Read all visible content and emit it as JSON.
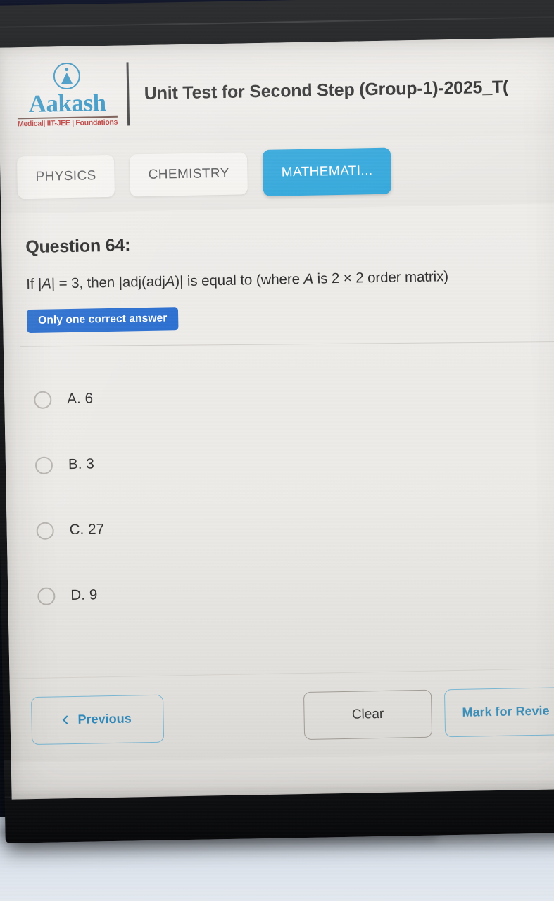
{
  "app": {
    "exam_title": "Unit Test for Second Step (Group-1)-2025_T(",
    "logo": {
      "word": "Aakash",
      "subtitle": "Medical| IIT-JEE | Foundations",
      "mark_icon": "aakash-circle-icon"
    }
  },
  "tabs": [
    {
      "label": "PHYSICS",
      "active": false
    },
    {
      "label": "CHEMISTRY",
      "active": false
    },
    {
      "label": "MATHEMATI...",
      "active": true
    }
  ],
  "question": {
    "number_label": "Question 64:",
    "text_part1": "If |",
    "text_italic1": "A",
    "text_part2": "| = 3, then |adj(adj",
    "text_italic2": "A",
    "text_part3": ")| is equal to (where ",
    "text_italic3": "A",
    "text_part4": " is 2 × 2 order matrix)",
    "full_text": "If |A| = 3, then |adj(adjA)| is equal to (where A is 2 × 2 order matrix)",
    "answer_type_badge": "Only one correct answer",
    "options": [
      {
        "label": "A. 6",
        "selected": false
      },
      {
        "label": "B. 3",
        "selected": false
      },
      {
        "label": "C. 27",
        "selected": false
      },
      {
        "label": "D. 9",
        "selected": false
      }
    ]
  },
  "actions": {
    "previous_label": "Previous",
    "clear_label": "Clear",
    "mark_label": "Mark for Revie"
  },
  "colors": {
    "active_tab_blue": "#34a8dc",
    "badge_blue": "#2b6fd0",
    "logo_blue": "#2b8fc1",
    "logo_red": "#b8312f",
    "outline_blue": "#7fc0de",
    "screen_bg": "#efedea"
  }
}
